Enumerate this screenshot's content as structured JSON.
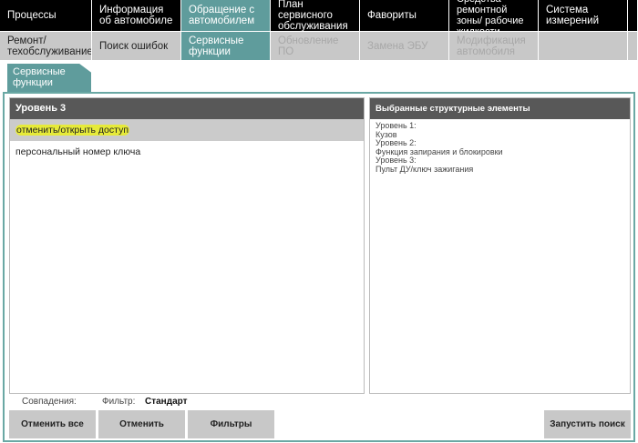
{
  "nav": [
    {
      "label": "Процессы",
      "active": false
    },
    {
      "label": "Информация об автомобиле",
      "active": false
    },
    {
      "label": "Обращение с автомобилем",
      "active": true
    },
    {
      "label": "План сервисного обслуживания",
      "active": false
    },
    {
      "label": "Фавориты",
      "active": false
    },
    {
      "label": "Средства ремонтной зоны/ рабочие жидкости",
      "active": false
    },
    {
      "label": "Система измерений",
      "active": false
    }
  ],
  "subnav": [
    {
      "label": "Ремонт/ техобслуживание",
      "state": "normal"
    },
    {
      "label": "Поиск ошибок",
      "state": "normal"
    },
    {
      "label": "Сервисные функции",
      "state": "active"
    },
    {
      "label": "Обновление ПО",
      "state": "disabled"
    },
    {
      "label": "Замена ЭБУ",
      "state": "disabled"
    },
    {
      "label": "Модификация автомобиля",
      "state": "disabled"
    }
  ],
  "tab": {
    "label": "Сервисные функции"
  },
  "left": {
    "header": "Уровень 3",
    "items": [
      {
        "label": "отменить/открыть доступ",
        "selected": true
      },
      {
        "label": "персональный номер ключа",
        "selected": false
      }
    ]
  },
  "right": {
    "header": "Выбранные структурные элементы",
    "lines": [
      "Уровень 1:",
      "Кузов",
      "Уровень 2:",
      "Функция запирания и блокировки",
      "Уровень 3:",
      "Пульт ДУ/ключ зажигания"
    ]
  },
  "footer": {
    "matches_label": "Совпадения:",
    "filter_label": "Фильтр:",
    "filter_value": "Стандарт"
  },
  "buttons": {
    "cancel_all": "Отменить все",
    "cancel": "Отменить",
    "filters": "Фильтры",
    "start_search": "Запустить поиск"
  },
  "colors": {
    "accent": "#5f9c9c",
    "highlight": "#e6ea3a"
  }
}
